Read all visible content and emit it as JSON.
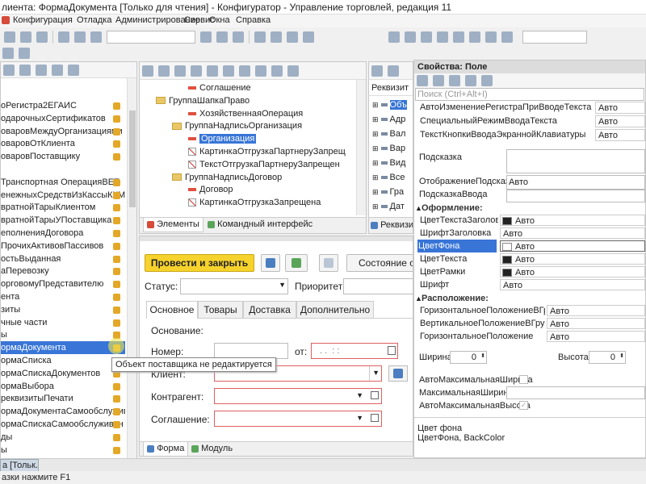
{
  "title_bar": {
    "text": "лиента: ФормаДокумента [Только для чтения] - Конфигуратор - Управление торговлей, редакция 11"
  },
  "menu": [
    "Конфигурация",
    "Отладка",
    "Администрирование",
    "Сервис",
    "Окна",
    "Справка"
  ],
  "left_tree": {
    "items": [
      "оРегистра2ЕГАИС",
      "одарочныхСертификатов",
      "оваровМеждуОрганизациями",
      "оваровОтКлиента",
      "оваровПоставщику",
      "",
      "Транспортная ОперацияВЕТ",
      "енежныхСредствИзКассыККМ",
      "вратнойТарыКлиентом",
      "вратнойТарыУПоставщика",
      "еполненияДоговора",
      "ПрочихАктивовПассивов",
      "остьВыданная",
      "аПеревозку",
      "орговомуПредставителю",
      "ента",
      "зиты",
      "чные части",
      "ы",
      "ормаДокумента",
      "ормаСписка",
      "ормаСпискаДокументов",
      "ормаВыбора",
      "реквизитыПечати",
      "ормаДокументаСамообслужив...",
      "ормаСпискаСамообслуживан",
      "ды",
      "ы"
    ],
    "selected_index": 19,
    "tooltip": "Объект поставщика не редактируется"
  },
  "elements_tree": {
    "items": [
      {
        "label": "Соглашение",
        "type": "field",
        "indent": 3
      },
      {
        "label": "ГруппаШапкаПраво",
        "type": "group",
        "indent": 1
      },
      {
        "label": "ХозяйственнаяОперация",
        "type": "field",
        "indent": 3
      },
      {
        "label": "ГруппаНадписьОрганизация",
        "type": "group",
        "indent": 2
      },
      {
        "label": "Организация",
        "type": "field-selected",
        "indent": 3
      },
      {
        "label": "КартинкаОтгрузкаПартнеруЗапрещ",
        "type": "pic",
        "indent": 3
      },
      {
        "label": "ТекстОтгрузкаПартнеруЗапрещен",
        "type": "pic",
        "indent": 3
      },
      {
        "label": "ГруппаНадписьДоговор",
        "type": "group",
        "indent": 2
      },
      {
        "label": "Договор",
        "type": "field",
        "indent": 3
      },
      {
        "label": "КартинкаОтгрузкаЗапрещена",
        "type": "pic",
        "indent": 3
      }
    ],
    "tab_elements": "Элементы",
    "tab_commands": "Командный интерфейс"
  },
  "requisites": {
    "header": "Реквизит",
    "items": [
      "Объ",
      "Адр",
      "Вал",
      "Вар",
      "Вид",
      "Все",
      "Гра",
      "Дат"
    ],
    "tab": "Реквизиты"
  },
  "form_preview": {
    "post_close": "Провести и закрыть",
    "state_btn": "Состояние об",
    "status_label": "Статус:",
    "priority_label": "Приоритет:",
    "tabs": [
      "Основное",
      "Товары",
      "Доставка",
      "Дополнительно"
    ],
    "basis_label": "Основание:",
    "number_label": "Номер:",
    "from_label": "от:",
    "date_mask": ". .  : :",
    "client_label": "Клиент:",
    "counterparty_label": "Контрагент:",
    "agreement_label": "Соглашение:",
    "bottom_tab_form": "Форма",
    "bottom_tab_module": "Модуль"
  },
  "properties": {
    "title": "Свойства: Поле",
    "search_placeholder": "Поиск (Ctrl+Alt+I)",
    "rows_top": [
      {
        "label": "АвтоИзменениеРегистраПриВводеТекста",
        "value": "Авто"
      },
      {
        "label": "СпециальныйРежимВводаТекста",
        "value": "Авто"
      },
      {
        "label": "ТекстКнопкиВводаЭкраннойКлавиатуры",
        "value": "Авто"
      }
    ],
    "hint_label": "Подсказка",
    "hint_display_label": "ОтображениеПодсказки",
    "hint_display_value": "Авто",
    "hint_input_label": "ПодсказкаВвода",
    "design_section": "Оформление:",
    "design_rows": [
      {
        "label": "ЦветТекстаЗаголовка",
        "value": "Авто",
        "swatch": "#222222"
      },
      {
        "label": "ШрифтЗаголовка",
        "value": "Авто",
        "swatch": ""
      },
      {
        "label": "ЦветФона",
        "value": "Авто",
        "swatch": "#ffffff",
        "selected": true
      },
      {
        "label": "ЦветТекста",
        "value": "Авто",
        "swatch": "#222222"
      },
      {
        "label": "ЦветРамки",
        "value": "Авто",
        "swatch": "#222222"
      },
      {
        "label": "Шрифт",
        "value": "Авто",
        "swatch": ""
      }
    ],
    "layout_section": "Расположение:",
    "layout_rows": [
      {
        "label": "ГоризонтальноеПоложениеВГруппе",
        "value": "Авто"
      },
      {
        "label": "ВертикальноеПоложениеВГруппе",
        "value": "Авто"
      },
      {
        "label": "ГоризонтальноеПоложение",
        "value": "Авто"
      }
    ],
    "width_label": "Ширина",
    "width_value": "0",
    "height_label": "Высота",
    "height_value": "0",
    "auto_max_width_label": "АвтоМаксимальнаяШирина",
    "max_width_label": "МаксимальнаяШирина",
    "auto_max_height_label": "АвтоМаксимальнаяВысота",
    "desc_title": "Цвет фона",
    "desc_text": "ЦветФона, BackColor"
  },
  "taskbar_item": "а [Тольк...",
  "status_bar": "азки нажмите F1"
}
